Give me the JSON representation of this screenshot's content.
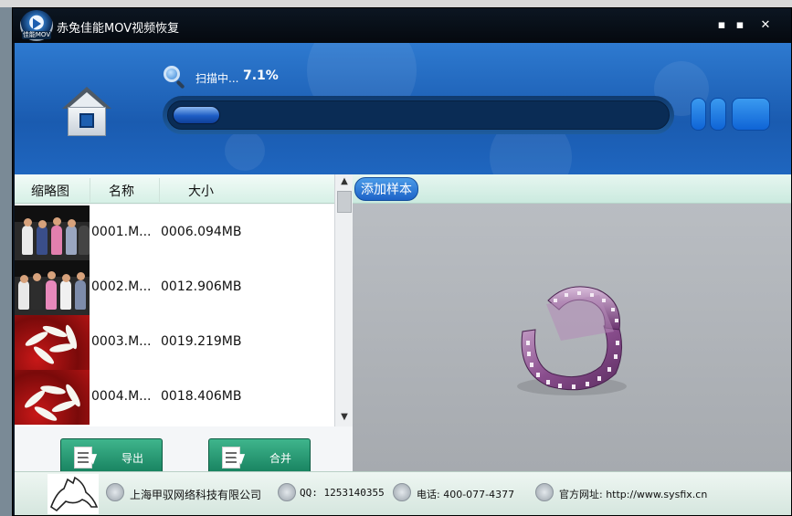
{
  "window": {
    "title": "赤兔佳能MOV视频恢复",
    "logo_badge": "佳能MOV",
    "controls": {
      "minimize": "▪",
      "maximize": "▪",
      "close": "✕"
    }
  },
  "scan": {
    "status_label": "扫描中...",
    "percent_text": "7.1%",
    "progress": 0.071
  },
  "file_table": {
    "columns": [
      "缩略图",
      "名称",
      "大小"
    ],
    "rows": [
      {
        "name": "0001.M...",
        "size": "0006.094MB",
        "thumb": "people-group"
      },
      {
        "name": "0002.M...",
        "size": "0012.906MB",
        "thumb": "people-group"
      },
      {
        "name": "0003.M...",
        "size": "0019.219MB",
        "thumb": "white-flower-red"
      },
      {
        "name": "0004.M...",
        "size": "0018.406MB",
        "thumb": "white-flower-red"
      }
    ]
  },
  "actions": {
    "export_label": "导出",
    "merge_label": "合并"
  },
  "right_panel": {
    "add_sample_label": "添加样本",
    "preview_icon": "film-reel-icon"
  },
  "footer": {
    "company": "上海甲驭网络科技有限公司",
    "qq": "QQ: 1253140355",
    "phone": "电话: 400-077-4377",
    "website": "官方网址: http://www.sysfix.cn"
  },
  "colors": {
    "title_bar": "#0a1420",
    "header_blue": "#1f66bf",
    "table_header": "#d6f0e6",
    "action_green": "#16805e",
    "preview_bg": "#a6aaaf"
  }
}
